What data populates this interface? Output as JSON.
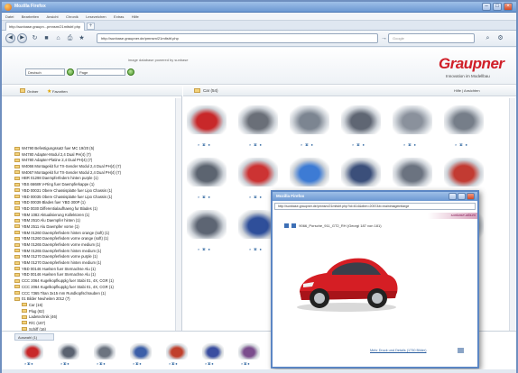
{
  "window": {
    "title": "Mozilla Firefox"
  },
  "menu": [
    "Datei",
    "Bearbeiten",
    "Ansicht",
    "Chronik",
    "Lesezeichen",
    "Extras",
    "Hilfe"
  ],
  "tab": {
    "label": "http://sunbase.graupn...pmnsm/21mltshf.php"
  },
  "url": "http://sunbase.graupner.de/pmnsm/21mltshf.php",
  "search_placeholder": "Google",
  "header": {
    "powered": "image database powered by sunbase",
    "lang_value": "Deutsch",
    "search_value": "Page",
    "logo": "Graupner",
    "logo_sub": "Innovation im Modellbau"
  },
  "left": {
    "tabs": [
      "Ordner",
      "Favoriten"
    ],
    "tree": [
      "W4790 Befestigungssatz fuer MC 19/20 (5)",
      "W4780 Adapter-Modul 2,4 Dual PH(4) (7)",
      "W4780 Adapter-Platine 2,4 Dual PH(4) (7)",
      "W4066 Montagekit fur TX-Sender Modul 2,4 Dual PH(4) (7)",
      "W4067 Montagekit fur TX-Sender Modul 2,4 Dual PH(4) (7)",
      "HBR 01298 Daempferfedern hinten purple (1)",
      "YBS 66689 V-Ring fuer Daempferkappe (1)",
      "YBD 00031 Obere Chassisplatte fuer Lipo Chassis (1)",
      "YBD 00035 Obere Chassisplatte fuer Lipo Chassis (1)",
      "YBD 00039 Blades fuer YBD 300P (1)",
      "YBD 0030 Differentialaufhaeng fur Blades (1)",
      "YBM 1082 Aktualisierung Kollektoren (1)",
      "YBM 2510 Alu Daempfer hinten (1)",
      "YBM 2511 Alu Daempfer vorne (1)",
      "YBM 01260 Daempferfedern hinten orange (soft) (1)",
      "YBM 01260 Daempferfedern vorne orange (soft) (1)",
      "YBM 01265 Daempferfedern vorne medium (1)",
      "YBM 01265 Daempferfedern hinten medium (1)",
      "YBM 01270 Daempferfedern vorne purple (1)",
      "YBM 01270 Daempferfedern hinten medium (1)",
      "YBD 00146 Huelsen fuer Sternachse Alu (1)",
      "YBD 00146 Huelsen fuer Sternachse Alu (1)",
      "CCC 2064 Kugelkopfkupplg fuer Stabi 01, 4X, CGR (1)",
      "CCC 2064 Kugelkopfkupplg fuer Stabi 01, 4X, CGR (1)",
      "CCC 7365 Titan 3x15 mm Rundkopfschrauben (1)",
      "01 Bilder Neuheiten 2012 (7)",
      "Car (16)",
      "Plug (62)",
      "Ladetechnik (46)",
      "R/C (167)",
      "Schiff (16)",
      "Zubehor (46)"
    ]
  },
  "right": {
    "title": "Car (54)",
    "top_right": "Hilfe | Ansichten",
    "thumbs": [
      {
        "caption": "",
        "color": "#c8282a"
      },
      {
        "caption": "",
        "color": "#6a6f78"
      },
      {
        "caption": "",
        "color": "#7c8591"
      },
      {
        "caption": "",
        "color": "#5f6673"
      },
      {
        "caption": "",
        "color": "#8a919c"
      },
      {
        "caption": "",
        "color": "#767e89"
      },
      {
        "caption": "",
        "color": "#5c6470"
      },
      {
        "caption": "",
        "color": "#cc3333"
      },
      {
        "caption": "",
        "color": "#3d7bd4"
      },
      {
        "caption": "",
        "color": "#3b4f7a"
      },
      {
        "caption": "",
        "color": "#6b7380"
      },
      {
        "caption": "",
        "color": "#c23b32"
      },
      {
        "caption": "",
        "color": "#5d6573"
      },
      {
        "caption": "",
        "color": "#2f4f9a"
      },
      {
        "caption": "",
        "color": "#70797f"
      },
      {
        "caption": "",
        "color": "#808896"
      },
      {
        "caption": "",
        "color": "#a3343a"
      },
      {
        "caption": "",
        "color": "#777f8a"
      }
    ]
  },
  "bottom": {
    "tab": "Auswahl (1)",
    "thumbs": [
      "#c8282a",
      "#5a6270",
      "#6c7480",
      "#3c5fa8",
      "#c0402c",
      "#3a4ea0",
      "#7a4c8c",
      "#b03036",
      "#5b6370",
      "#6d7482",
      "#c62a2a"
    ]
  },
  "popup": {
    "title": "Mozilla Firefox",
    "url": "http://sunbase.graupner.de/pmnsm/21mltshf.php?id=614&dbm=2057&b=mainimageintlarge",
    "brand": "sunbase-album",
    "nav": "9066_Porsche_911_GT2_RH (Georgi 187 von 181)",
    "footer": "Mehr Druck und Details (1730 Bilder)"
  }
}
